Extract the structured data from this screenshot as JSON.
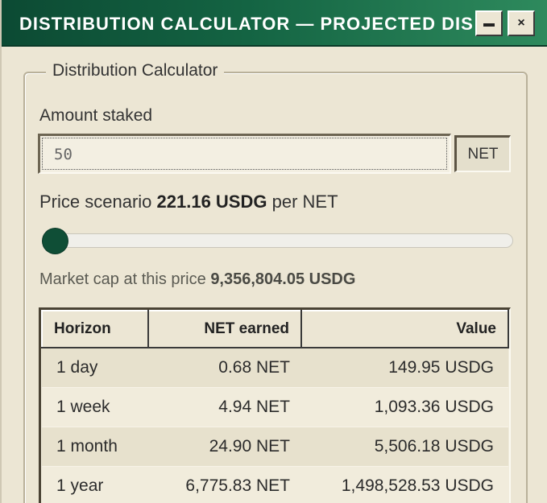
{
  "window": {
    "title": "DISTRIBUTION CALCULATOR — PROJECTED DIS…",
    "minimize_icon": "minimize-icon",
    "close_label": "×"
  },
  "group": {
    "legend": "Distribution Calculator"
  },
  "amount": {
    "label": "Amount staked",
    "value": "50",
    "unit": "NET"
  },
  "price": {
    "prefix": "Price scenario",
    "value": "221.16 USDG",
    "suffix": "per NET",
    "slider_fraction": 0.0
  },
  "market_cap": {
    "prefix": "Market cap at this price",
    "value": "9,356,804.05 USDG"
  },
  "table": {
    "headers": [
      "Horizon",
      "NET earned",
      "Value"
    ],
    "rows": [
      {
        "horizon": "1 day",
        "earned": "0.68 NET",
        "value": "149.95 USDG"
      },
      {
        "horizon": "1 week",
        "earned": "4.94 NET",
        "value": "1,093.36 USDG"
      },
      {
        "horizon": "1 month",
        "earned": "24.90 NET",
        "value": "5,506.18 USDG"
      },
      {
        "horizon": "1 year",
        "earned": "6,775.83 NET",
        "value": "1,498,528.53 USDG"
      }
    ]
  },
  "colors": {
    "titlebar": "#146443",
    "accent": "#0f4e36",
    "background": "#ece6d4"
  }
}
